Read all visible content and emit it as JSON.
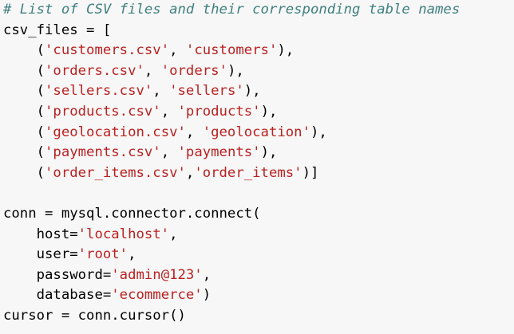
{
  "editor": {
    "lines": [
      [
        {
          "t": "# List of CSV files and their corresponding table names",
          "k": "comment"
        }
      ],
      [
        {
          "t": "csv_files = [",
          "k": "plain"
        }
      ],
      [
        {
          "t": "    (",
          "k": "plain"
        },
        {
          "t": "'customers.csv'",
          "k": "str"
        },
        {
          "t": ", ",
          "k": "plain"
        },
        {
          "t": "'customers'",
          "k": "str"
        },
        {
          "t": "),",
          "k": "plain"
        }
      ],
      [
        {
          "t": "    (",
          "k": "plain"
        },
        {
          "t": "'orders.csv'",
          "k": "str"
        },
        {
          "t": ", ",
          "k": "plain"
        },
        {
          "t": "'orders'",
          "k": "str"
        },
        {
          "t": "),",
          "k": "plain"
        }
      ],
      [
        {
          "t": "    (",
          "k": "plain"
        },
        {
          "t": "'sellers.csv'",
          "k": "str"
        },
        {
          "t": ", ",
          "k": "plain"
        },
        {
          "t": "'sellers'",
          "k": "str"
        },
        {
          "t": "),",
          "k": "plain"
        }
      ],
      [
        {
          "t": "    (",
          "k": "plain"
        },
        {
          "t": "'products.csv'",
          "k": "str"
        },
        {
          "t": ", ",
          "k": "plain"
        },
        {
          "t": "'products'",
          "k": "str"
        },
        {
          "t": "),",
          "k": "plain"
        }
      ],
      [
        {
          "t": "    (",
          "k": "plain"
        },
        {
          "t": "'geolocation.csv'",
          "k": "str"
        },
        {
          "t": ", ",
          "k": "plain"
        },
        {
          "t": "'geolocation'",
          "k": "str"
        },
        {
          "t": "),",
          "k": "plain"
        }
      ],
      [
        {
          "t": "    (",
          "k": "plain"
        },
        {
          "t": "'payments.csv'",
          "k": "str"
        },
        {
          "t": ", ",
          "k": "plain"
        },
        {
          "t": "'payments'",
          "k": "str"
        },
        {
          "t": "),",
          "k": "plain"
        }
      ],
      [
        {
          "t": "    (",
          "k": "plain"
        },
        {
          "t": "'order_items.csv'",
          "k": "str"
        },
        {
          "t": ",",
          "k": "plain"
        },
        {
          "t": "'order_items'",
          "k": "str"
        },
        {
          "t": ")]",
          "k": "plain"
        }
      ],
      [
        {
          "t": "",
          "k": "plain"
        }
      ],
      [
        {
          "t": "conn = mysql.connector.connect(",
          "k": "plain"
        }
      ],
      [
        {
          "t": "    host=",
          "k": "plain"
        },
        {
          "t": "'localhost'",
          "k": "str"
        },
        {
          "t": ",",
          "k": "plain"
        }
      ],
      [
        {
          "t": "    user=",
          "k": "plain"
        },
        {
          "t": "'root'",
          "k": "str"
        },
        {
          "t": ",",
          "k": "plain"
        }
      ],
      [
        {
          "t": "    password=",
          "k": "plain"
        },
        {
          "t": "'admin@123'",
          "k": "str"
        },
        {
          "t": ",",
          "k": "plain"
        }
      ],
      [
        {
          "t": "    database=",
          "k": "plain"
        },
        {
          "t": "'ecommerce'",
          "k": "str"
        },
        {
          "t": ")",
          "k": "plain"
        }
      ],
      [
        {
          "t": "cursor = conn.cursor()",
          "k": "plain"
        }
      ]
    ]
  },
  "colors": {
    "background": "#f7f7f7",
    "comment": "#408080",
    "string": "#ba2121",
    "text": "#000000"
  }
}
